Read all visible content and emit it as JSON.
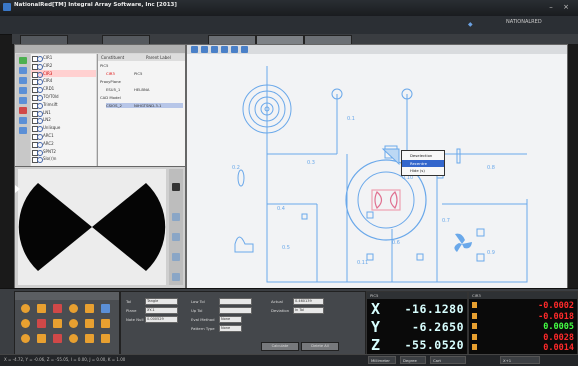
{
  "window": {
    "title": "NationalRed[TM] Integral Array Software, Inc [2013]",
    "subtitle": "",
    "colors": {
      "accent": "#3a78c8",
      "canvas_line": "#5aa0e6",
      "dro_text": "#d8ffff",
      "error_red": "#ff2a2a",
      "ok_green": "#44ff44"
    }
  },
  "topstrip": {
    "brand_text": "NATIONALRED"
  },
  "feature_tree": {
    "items": [
      {
        "label": "CIR1",
        "icon": "circle-icon"
      },
      {
        "label": "CIR2",
        "icon": "circle-icon"
      },
      {
        "label": "CIR3",
        "icon": "circle-icon",
        "selected": true
      },
      {
        "label": "CIR4",
        "icon": "circle-icon"
      },
      {
        "label": "CRD1",
        "icon": "angle-icon"
      },
      {
        "label": "TO/T0ld",
        "icon": "line-icon"
      },
      {
        "label": "Trimsift",
        "icon": "line-icon"
      },
      {
        "label": "LN1",
        "icon": "line-icon"
      },
      {
        "label": "LN2",
        "icon": "line-icon"
      },
      {
        "label": "Unlisque",
        "icon": "sphere-icon"
      },
      {
        "label": "ARC1",
        "icon": "arc-icon"
      },
      {
        "label": "ARC2",
        "icon": "arc-icon"
      },
      {
        "label": "SPNT2",
        "icon": "point-icon"
      },
      {
        "label": "Slo(r)n",
        "icon": "slot-icon"
      }
    ]
  },
  "properties": {
    "col1": "Constituent",
    "col2": "Parent Label",
    "rows": [
      {
        "indent": 0,
        "text": "PIC5"
      },
      {
        "indent": 1,
        "text": "CIR3",
        "text2": "PIC5",
        "red": true
      },
      {
        "indent": 0,
        "text": "ProxyPlane"
      },
      {
        "indent": 1,
        "text": "ESU5_1",
        "text2": "HELBNA"
      },
      {
        "indent": 0,
        "text": "CAD Model"
      },
      {
        "indent": 1,
        "text": "CSIOS_2",
        "text2": "NIHGTSND.3.1",
        "highlight": true
      }
    ]
  },
  "canvas": {
    "labels": {
      "c1": "0.1",
      "c2": "0.2",
      "c3": "0.3",
      "c4": "0.4",
      "c5": "0.5",
      "c6": "0.6",
      "c7": "0.7",
      "c8": "0.8",
      "c9": "0.9",
      "c10": "0.10",
      "c11": "0.11"
    }
  },
  "context_menu": {
    "items": [
      {
        "label": "Deselection",
        "selected": false
      },
      {
        "label": "Recentre",
        "selected": true
      },
      {
        "label": "Hide (s)",
        "selected": false
      }
    ]
  },
  "operation_form": {
    "tol_label": "Tol",
    "tol_value": "Tangle",
    "plane_label": "Plane",
    "plane_value": "XY-1",
    "note_label": "Note Null",
    "note_value": "0.000529",
    "low_tol_label": "Low Tol",
    "low_tol_value": "",
    "up_tol_label": "Up Tol",
    "up_tol_value": "",
    "evaluation_label": "Eval Method",
    "evaluation_value": "None",
    "pattern_label": "Pattern Type",
    "pattern_value": "None",
    "actual_label": "Actual",
    "actual_value": "0.460139",
    "deviation_label": "Deviation",
    "deviation_value": "In Tol",
    "btn_calculate": "Calculate",
    "btn_deleteall": "Delete All"
  },
  "dro_axes": {
    "header_label": "PIC5",
    "x_axis": "X",
    "x_value": "-16.1280",
    "y_axis": "Y",
    "y_value": "-6.2650",
    "z_axis": "Z",
    "z_value": "-55.0520"
  },
  "dro_errors": {
    "header_label": "CIR3",
    "rows": [
      {
        "value": "-0.0002",
        "color": "#ff2a2a"
      },
      {
        "value": "-0.0018",
        "color": "#ff2a2a"
      },
      {
        "value": "0.0005",
        "color": "#44ff44"
      },
      {
        "value": "0.0028",
        "color": "#ff2a2a"
      },
      {
        "value": "0.0014",
        "color": "#ff2a2a"
      }
    ]
  },
  "statusbar": {
    "coords": "X = -4.72,  Y = -0.06,  Z = -55.05,  I = 0.00,  J = 0.00,  K = 1.00",
    "units": "Millimeter",
    "angle": "Degree",
    "mode": "Cart",
    "extra": "X+1"
  }
}
